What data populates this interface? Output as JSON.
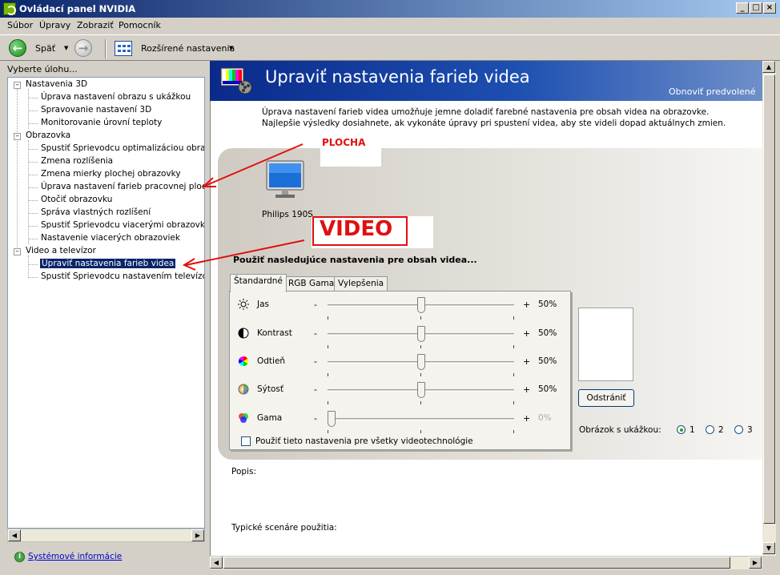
{
  "window": {
    "title": "Ovládací panel NVIDIA"
  },
  "menu": [
    "Súbor",
    "Úpravy",
    "Zobraziť",
    "Pomocník"
  ],
  "toolbar": {
    "back_label": "Späť",
    "advanced_label": "Rozšírené nastavenia"
  },
  "left_panel": {
    "task_label": "Vyberte úlohu...",
    "tree": [
      {
        "label": "Nastavenia 3D",
        "level": 0
      },
      {
        "label": "Úprava nastavení obrazu s ukážkou",
        "level": 1
      },
      {
        "label": "Spravovanie nastavení 3D",
        "level": 1
      },
      {
        "label": "Monitorovanie úrovní teploty",
        "level": 1
      },
      {
        "label": "Obrazovka",
        "level": 0
      },
      {
        "label": "Spustiť Sprievodcu optimalizáciou obrazovk",
        "level": 1
      },
      {
        "label": "Zmena rozlíšenia",
        "level": 1
      },
      {
        "label": "Zmena mierky plochej obrazovky",
        "level": 1
      },
      {
        "label": "Úprava nastavení farieb pracovnej plochy",
        "level": 1
      },
      {
        "label": "Otočiť obrazovku",
        "level": 1
      },
      {
        "label": "Správa vlastných rozlíšení",
        "level": 1
      },
      {
        "label": "Spustiť Sprievodcu viacerými obrazovkami",
        "level": 1
      },
      {
        "label": "Nastavenie viacerých obrazoviek",
        "level": 1
      },
      {
        "label": "Video a televízor",
        "level": 0
      },
      {
        "label": "Upraviť nastavenia farieb videa",
        "level": 1,
        "selected": true
      },
      {
        "label": "Spustiť Sprievodcu nastavením televízora",
        "level": 1
      }
    ],
    "system_info_link": "Systémové informácie"
  },
  "page": {
    "title": "Upraviť nastavenia farieb videa",
    "restore_link": "Obnoviť predvolené",
    "intro": "Úprava nastavení farieb videa umožňuje jemne doladiť farebné nastavenia pre obsah videa na obrazovke.  Najlepšie výsledky dosiahnete, ak vykonáte úpravy pri spustení videa, aby ste videli dopad aktuálnych zmien.",
    "monitor_label": "Philips 190S",
    "apply_heading": "Použiť nasledujúce nastavenia pre obsah videa...",
    "tabs": [
      "Štandardné",
      "RGB Gama",
      "Vylepšenia"
    ],
    "sliders": [
      {
        "label": "Jas",
        "minus": "-",
        "plus": "+",
        "value_text": "50%",
        "value": 0.5,
        "enabled": true,
        "icon": "brightness-icon"
      },
      {
        "label": "Kontrast",
        "minus": "-",
        "plus": "+",
        "value_text": "50%",
        "value": 0.5,
        "enabled": true,
        "icon": "contrast-icon"
      },
      {
        "label": "Odtieň",
        "minus": "-",
        "plus": "+",
        "value_text": "50%",
        "value": 0.5,
        "enabled": true,
        "icon": "hue-icon"
      },
      {
        "label": "Sýtosť",
        "minus": "-",
        "plus": "+",
        "value_text": "50%",
        "value": 0.5,
        "enabled": true,
        "icon": "saturation-icon"
      },
      {
        "label": "Gama",
        "minus": "-",
        "plus": "+",
        "value_text": "0%",
        "value": 0.0,
        "enabled": false,
        "icon": "gamma-icon"
      }
    ],
    "apply_all_label": "Použiť tieto nastavenia pre všetky videotechnológie",
    "remove_button": "Odstrániť",
    "sample_label": "Obrázok s ukážkou:",
    "sample_options": [
      "1",
      "2",
      "3"
    ],
    "sample_selected": "1",
    "description_label": "Popis:",
    "usage_label": "Typické scenáre použitia:"
  },
  "annotations": {
    "plocha": "PLOCHA",
    "video": "VIDEO"
  },
  "colors": {
    "banner": "#1d4fb0",
    "annotation": "#e01010",
    "selection": "#0a246a"
  }
}
